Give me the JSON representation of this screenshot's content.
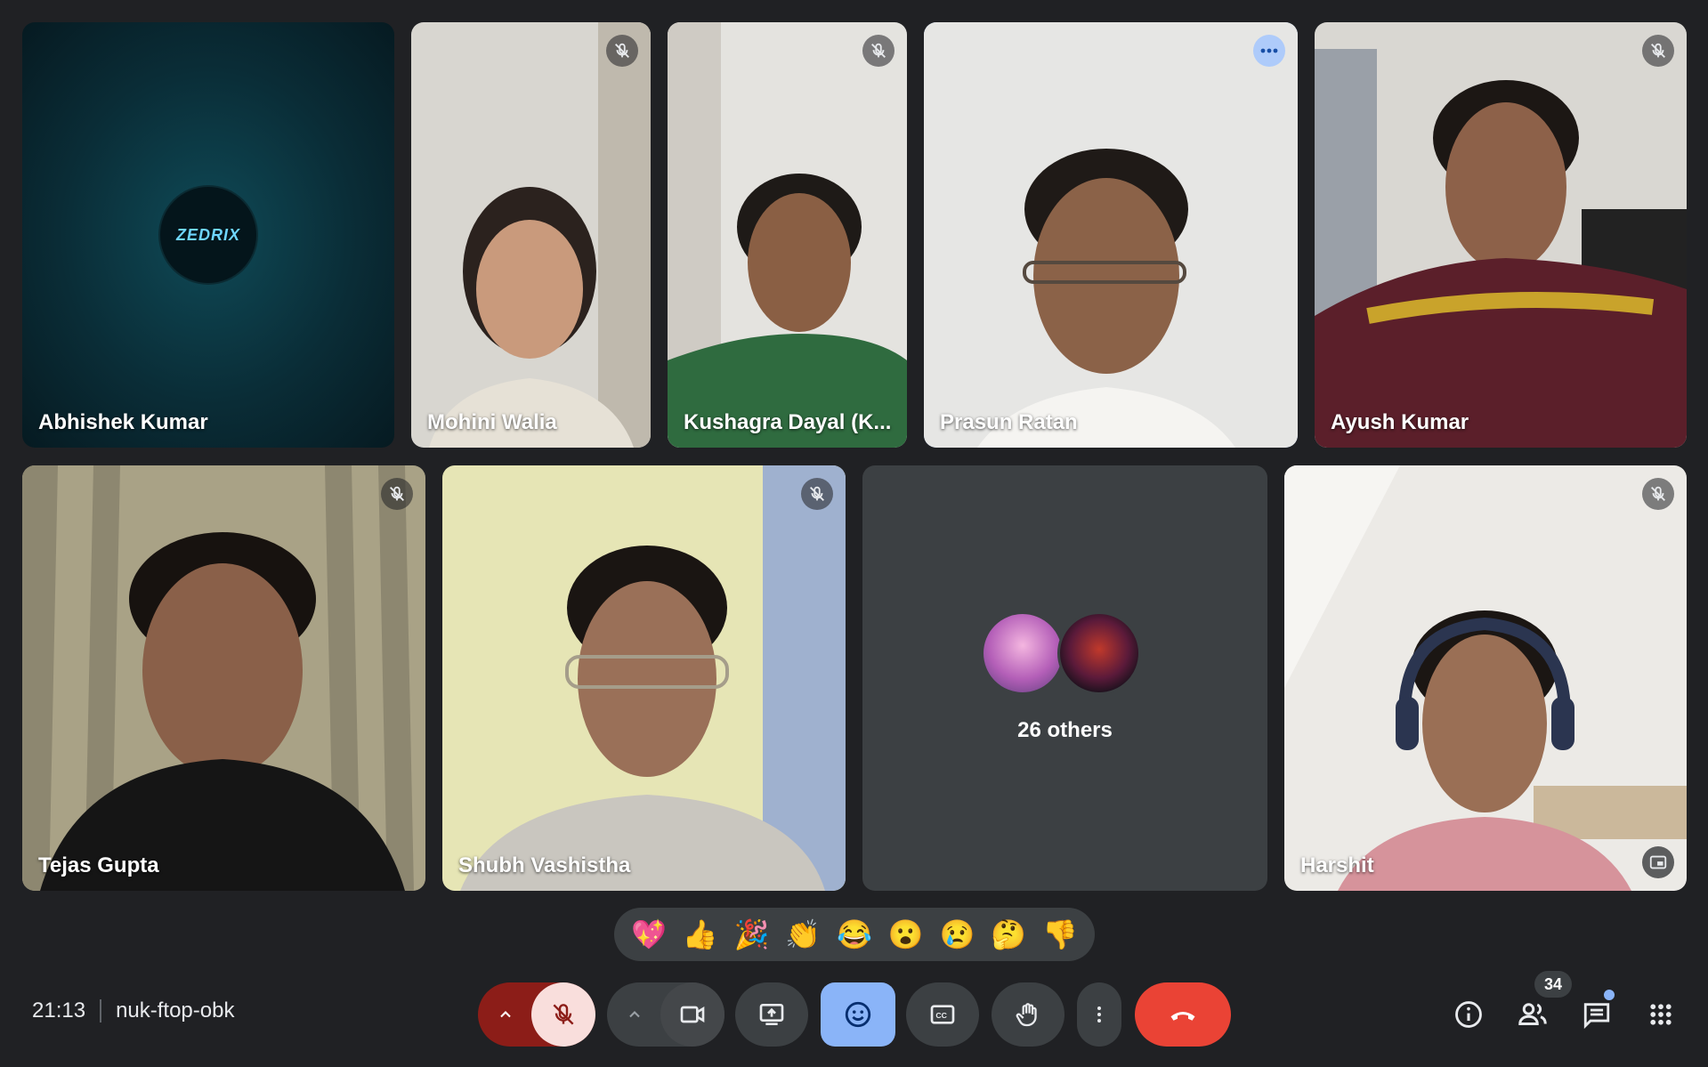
{
  "participants": [
    {
      "name": "Abhishek Kumar"
    },
    {
      "name": "Mohini Walia"
    },
    {
      "name": "Kushagra Dayal (K..."
    },
    {
      "name": "Prasun Ratan"
    },
    {
      "name": "Ayush Kumar"
    },
    {
      "name": "Tejas Gupta"
    },
    {
      "name": "Shubh Vashistha"
    },
    {
      "name": "Harshit"
    }
  ],
  "avatar_logo_text": "ZEDRIX",
  "others": {
    "label": "26 others"
  },
  "reactions": [
    "💖",
    "👍",
    "🎉",
    "👏",
    "😂",
    "😮",
    "😢",
    "🤔",
    "👎"
  ],
  "meeting": {
    "time": "21:13",
    "code": "nuk-ftop-obk"
  },
  "people_count": "34",
  "colors": {
    "background": "#202124",
    "tile": "#3c4043",
    "end_call": "#ea4335",
    "active": "#8ab4f8",
    "mic_off": "#f9dedc"
  },
  "icons": [
    "mic-off-icon",
    "chevron-up-icon",
    "video-camera-icon",
    "present-icon",
    "emoji-icon",
    "captions-icon",
    "raise-hand-icon",
    "more-vert-icon",
    "end-call-icon",
    "info-icon",
    "people-icon",
    "chat-icon",
    "apps-icon",
    "more-horiz-icon",
    "picture-in-picture-icon"
  ]
}
